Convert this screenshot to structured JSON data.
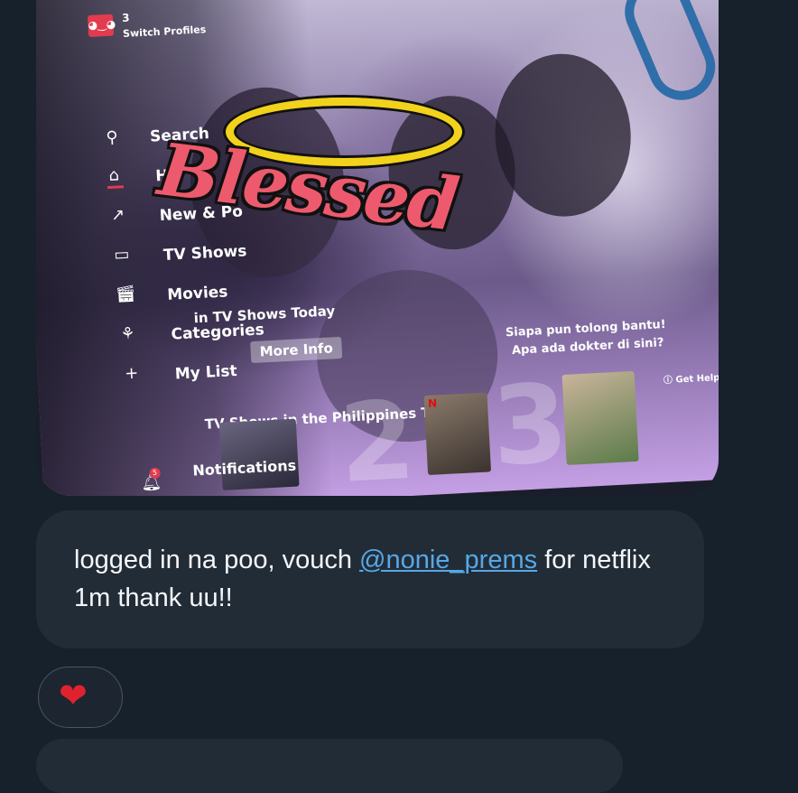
{
  "tv": {
    "profile": {
      "count": "3",
      "label": "Switch Profiles"
    },
    "nav": [
      {
        "label": "Search",
        "icon": "search-icon"
      },
      {
        "label": "H",
        "icon": "home-icon"
      },
      {
        "label": "New & Po",
        "icon": "new-popular-icon"
      },
      {
        "label": "TV Shows",
        "icon": "tv-icon"
      },
      {
        "label": "Movies",
        "icon": "movies-icon"
      },
      {
        "label": "Categories",
        "icon": "categories-icon"
      },
      {
        "label": "My List",
        "icon": "plus-icon"
      }
    ],
    "more_info": "More Info",
    "row1_title": "in TV Shows Today",
    "row2_title": "TV Shows in the Philippines Today",
    "subtitle_line1": "Siapa pun tolong bantu!",
    "subtitle_line2": "Apa ada dokter di sini?",
    "get_help": "Get Help",
    "notifications": {
      "label": "Notifications",
      "badge": "5"
    },
    "sticker_text": "Blessed",
    "thumb_logo": "N",
    "rank_numbers": [
      "2",
      "3"
    ]
  },
  "message": {
    "text_before": "logged in na poo, vouch ",
    "mention": "@nonie_prems",
    "text_after": " for netflix 1m thank uu!!"
  },
  "reaction": {
    "emoji": "❤"
  },
  "colors": {
    "bg": "#17212b",
    "bubble": "#222c37",
    "mention": "#56a8e6",
    "accent_red": "#e23b4e"
  }
}
